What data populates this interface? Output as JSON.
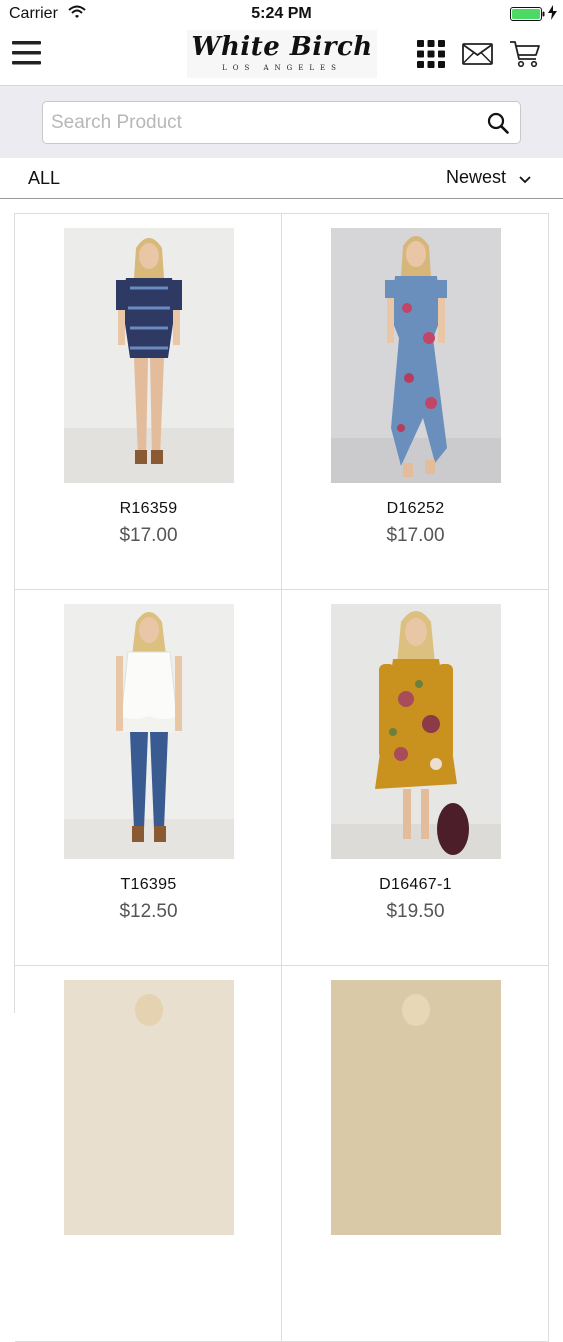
{
  "status": {
    "carrier": "Carrier",
    "time": "5:24 PM"
  },
  "header": {
    "logo_title": "White Birch",
    "logo_subtitle": "LOS ANGELES",
    "icons": [
      "menu-icon",
      "grid-icon",
      "mail-icon",
      "cart-icon"
    ]
  },
  "search": {
    "placeholder": "Search Product",
    "value": ""
  },
  "filter": {
    "category": "ALL",
    "sort": "Newest"
  },
  "products": [
    {
      "sku": "R16359",
      "price": "$17.00"
    },
    {
      "sku": "D16252",
      "price": "$17.00"
    },
    {
      "sku": "T16395",
      "price": "$12.50"
    },
    {
      "sku": "D16467-1",
      "price": "$19.50"
    },
    {
      "sku": "",
      "price": ""
    },
    {
      "sku": "",
      "price": ""
    }
  ],
  "colors": {
    "search_bg": "#ebebf1",
    "battery": "#4cd964",
    "price": "#555555",
    "divider": "#dcdcdc"
  }
}
